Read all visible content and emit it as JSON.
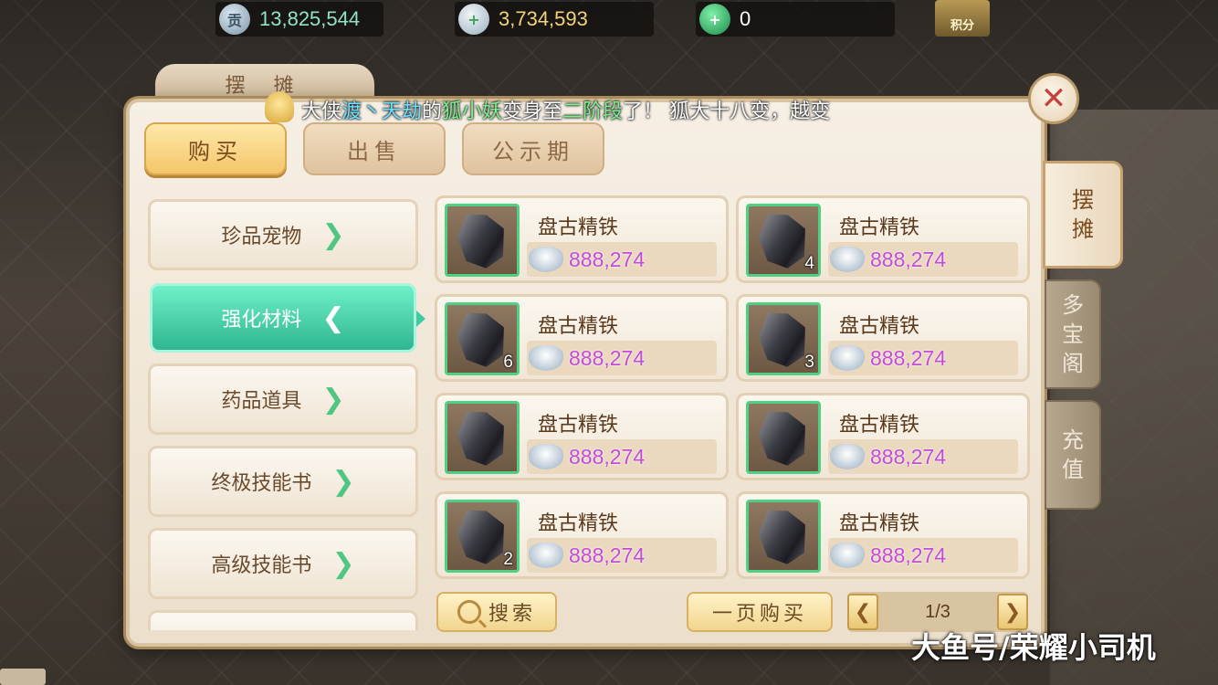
{
  "currency": {
    "gong": {
      "icon": "contribution-coin-icon",
      "glyph": "贡",
      "value": "13,825,544"
    },
    "silver": {
      "icon": "silver-ingot-icon",
      "glyph": "+",
      "value": "3,734,593"
    },
    "jade": {
      "icon": "jade-coin-icon",
      "glyph": "+",
      "value": "0"
    },
    "points": {
      "icon": "points-badge-icon",
      "label": "积分"
    }
  },
  "panel": {
    "title": "摆 摊",
    "close_glyph": "✕"
  },
  "announcement": {
    "prefix": "大侠",
    "player": "渡丶天劫",
    "mid1": "的",
    "pet": "狐小妖",
    "mid2": "变身至",
    "stage": "二阶段",
    "suffix": "了！ 狐大十八变，越变"
  },
  "top_tabs": [
    {
      "label": "购买",
      "active": true
    },
    {
      "label": "出售",
      "active": false
    },
    {
      "label": "公示期",
      "active": false
    }
  ],
  "side_tabs": [
    {
      "label": "摆摊",
      "chars": [
        "摆",
        "摊"
      ],
      "active": true
    },
    {
      "label": "多宝阁",
      "chars": [
        "多",
        "宝",
        "阁"
      ],
      "active": false
    },
    {
      "label": "充值",
      "chars": [
        "充",
        "值"
      ],
      "active": false
    }
  ],
  "categories": [
    {
      "label": "珍品宠物",
      "chevron": "❯",
      "active": false
    },
    {
      "label": "强化材料",
      "chevron": "❮",
      "active": true
    },
    {
      "label": "药品道具",
      "chevron": "❯",
      "active": false
    },
    {
      "label": "终极技能书",
      "chevron": "❯",
      "active": false
    },
    {
      "label": "高级技能书",
      "chevron": "❯",
      "active": false
    }
  ],
  "items": [
    {
      "name": "盘古精铁",
      "price": "888,274",
      "count": ""
    },
    {
      "name": "盘古精铁",
      "price": "888,274",
      "count": "4"
    },
    {
      "name": "盘古精铁",
      "price": "888,274",
      "count": "6"
    },
    {
      "name": "盘古精铁",
      "price": "888,274",
      "count": "3"
    },
    {
      "name": "盘古精铁",
      "price": "888,274",
      "count": ""
    },
    {
      "name": "盘古精铁",
      "price": "888,274",
      "count": ""
    },
    {
      "name": "盘古精铁",
      "price": "888,274",
      "count": "2"
    },
    {
      "name": "盘古精铁",
      "price": "888,274",
      "count": ""
    }
  ],
  "controls": {
    "search_label": "搜索",
    "buy_page_label": "一页购买",
    "prev_glyph": "❮",
    "next_glyph": "❯",
    "page_text": "1/3"
  },
  "watermark": "大鱼号/荣耀小司机",
  "colors": {
    "price": "#c44ad8",
    "active_category": "#2fb690",
    "active_tab": "#f3c66a"
  }
}
